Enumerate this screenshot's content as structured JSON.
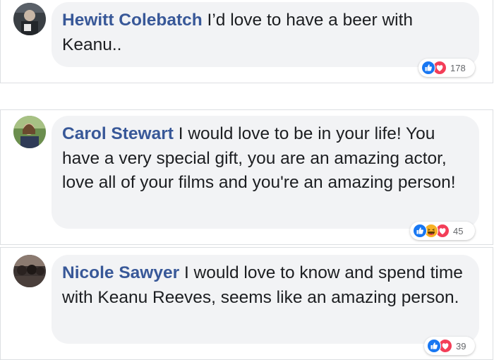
{
  "comments": [
    {
      "author": "Hewitt Colebatch",
      "text": " I’d love to have a beer with Keanu..",
      "reactions": [
        "like-icon",
        "love-icon"
      ],
      "reaction_count": "178"
    },
    {
      "author": "Carol Stewart",
      "text": " I would love to be in your life! You have a very special gift, you are an amazing actor, love all of your films and you're an amazing person!",
      "reactions": [
        "like-icon",
        "haha-icon",
        "love-icon"
      ],
      "reaction_count": "45"
    },
    {
      "author": "Nicole Sawyer",
      "text": " I would love to know and spend time with Keanu Reeves, seems like an amazing person.",
      "reactions": [
        "like-icon",
        "love-icon"
      ],
      "reaction_count": "39"
    }
  ],
  "colors": {
    "author_link": "#385898",
    "bubble_bg": "#f2f3f5",
    "like_blue": "#1877f2",
    "love_red": "#f33e58",
    "haha_yellow": "#f7b125"
  }
}
